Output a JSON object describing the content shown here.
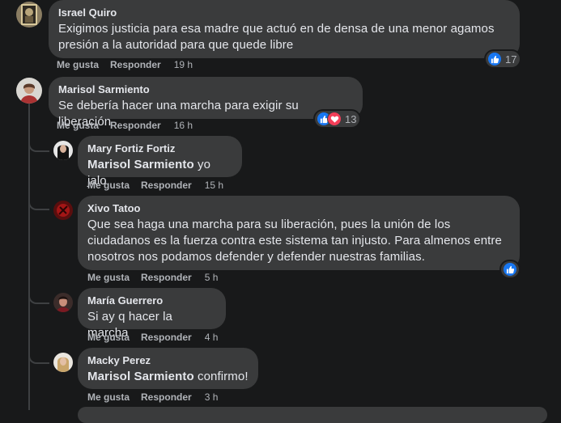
{
  "comments": [
    {
      "author": "Israel Quiro",
      "text": "Exigimos justicia para esa madre que actuó en de densa de una menor agamos presión a la autoridad para que quede libre",
      "like_label": "Me gusta",
      "reply_label": "Responder",
      "time": "19 h",
      "reaction_count": "17",
      "reactions": [
        "like-icon"
      ]
    },
    {
      "author": "Marisol Sarmiento",
      "text": "Se debería hacer una marcha para exigir su liberación",
      "like_label": "Me gusta",
      "reply_label": "Responder",
      "time": "16 h",
      "reaction_count": "13",
      "reactions": [
        "like-icon",
        "love-icon"
      ]
    }
  ],
  "replies": [
    {
      "author": "Mary Fortiz Fortiz",
      "mention": "Marisol Sarmiento",
      "text": " yo jalo",
      "like_label": "Me gusta",
      "reply_label": "Responder",
      "time": "15 h"
    },
    {
      "author": "Xivo Tatoo",
      "text": "Que sea haga una marcha para su liberación, pues la unión de los ciudadanos es la fuerza contra este sistema tan injusto. Para almenos entre nosotros nos podamos defender y defender nuestras familias.",
      "like_label": "Me gusta",
      "reply_label": "Responder",
      "time": "5 h",
      "reactions": [
        "like-icon"
      ]
    },
    {
      "author": "María Guerrero",
      "text": "Si ay q hacer la marcha",
      "like_label": "Me gusta",
      "reply_label": "Responder",
      "time": "4 h"
    },
    {
      "author": "Macky Perez",
      "mention": "Marisol Sarmiento",
      "text": " confirmo!",
      "like_label": "Me gusta",
      "reply_label": "Responder",
      "time": "3 h"
    }
  ],
  "colors": {
    "background": "#18191a",
    "bubble": "#3a3b3c",
    "text": "#e4e6eb",
    "secondary_text": "#b0b3b8",
    "like": "#1877f2",
    "love": "#f33e58"
  }
}
